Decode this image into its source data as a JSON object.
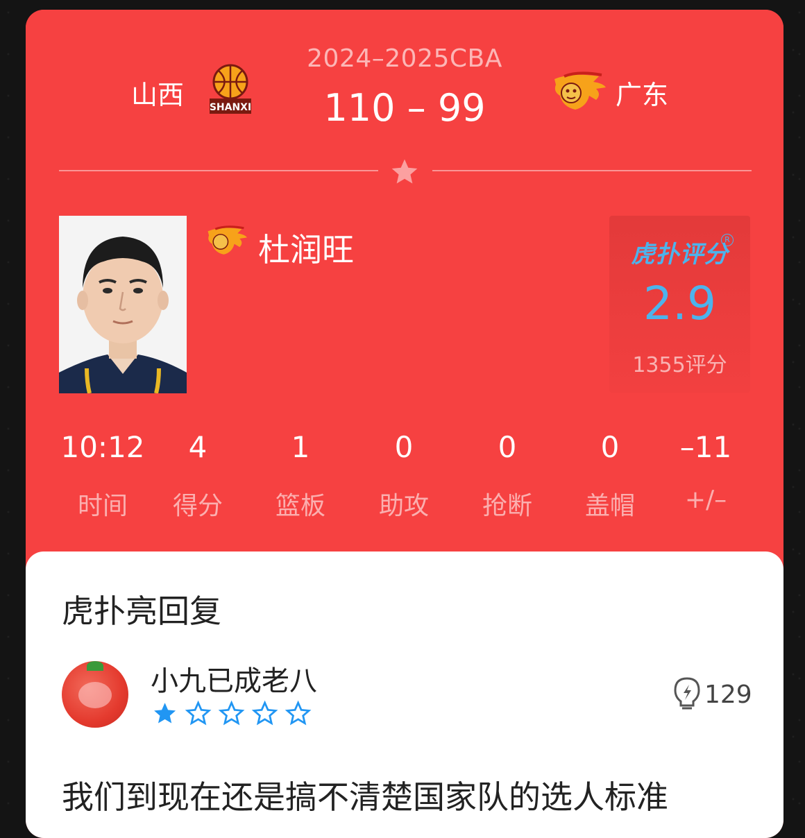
{
  "match": {
    "season": "2024–2025CBA",
    "score": "110 – 99",
    "home_team": "山西",
    "away_team": "广东",
    "home_logo_text": "SHANXI"
  },
  "player": {
    "name": "杜润旺"
  },
  "rating": {
    "brand": "虎扑评分",
    "value": "2.9",
    "count": "1355评分"
  },
  "stats": [
    {
      "value": "10:12",
      "label": "时间"
    },
    {
      "value": "4",
      "label": "得分"
    },
    {
      "value": "1",
      "label": "篮板"
    },
    {
      "value": "0",
      "label": "助攻"
    },
    {
      "value": "0",
      "label": "抢断"
    },
    {
      "value": "0",
      "label": "盖帽"
    },
    {
      "value": "–11",
      "label": "+/–"
    }
  ],
  "reply": {
    "title": "虎扑亮回复",
    "username": "小九已成老八",
    "stars_filled": 1,
    "stars_total": 5,
    "light_count": "129",
    "comment": "我们到现在还是搞不清楚国家队的选人标准"
  },
  "colors": {
    "card_red": "#f64141",
    "rating_blue": "#4db3ec",
    "star_blue": "#2196f3"
  }
}
